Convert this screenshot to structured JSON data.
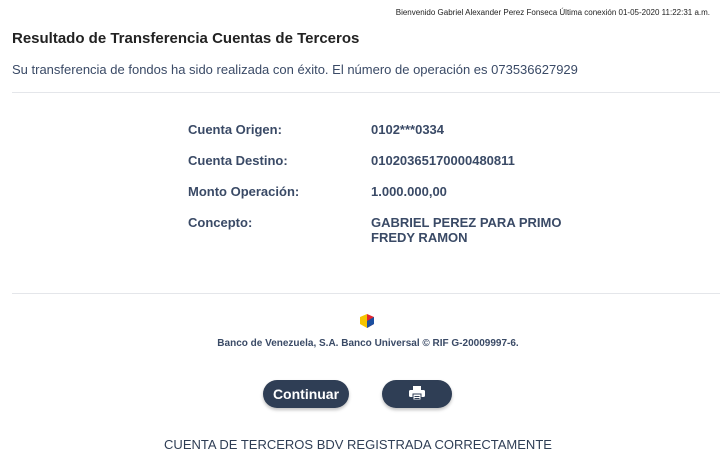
{
  "header": {
    "welcome": "Bienvenido Gabriel Alexander  Perez Fonseca  Última conexión 01-05-2020 11:22:31 a.m."
  },
  "page": {
    "title": "Resultado de Transferencia Cuentas de Terceros",
    "message": "Su transferencia de fondos ha sido realizada con éxito. El número de operación es 073536627929"
  },
  "details": [
    {
      "label": "Cuenta Origen:",
      "value": "0102***0334"
    },
    {
      "label": "Cuenta Destino:",
      "value": "01020365170000480811"
    },
    {
      "label": "Monto Operación:",
      "value": "1.000.000,00"
    },
    {
      "label": "Concepto:",
      "value_line1": "GABRIEL PEREZ PARA PRIMO",
      "value_line2": "FREDY RAMON"
    }
  ],
  "footer": {
    "bank_text": "Banco de Venezuela, S.A. Banco Universal © RIF G-20009997-6.",
    "logo_icon": "bdv-logo-icon",
    "logo_colors": [
      "#f6c400",
      "#e3262f",
      "#1b4fa0"
    ]
  },
  "buttons": {
    "continue_label": "Continuar",
    "print_icon": "printer-icon"
  },
  "status": "CUENTA DE TERCEROS BDV REGISTRADA CORRECTAMENTE",
  "colors": {
    "button_bg": "#2f3e55",
    "text_primary": "#3a4a66"
  }
}
